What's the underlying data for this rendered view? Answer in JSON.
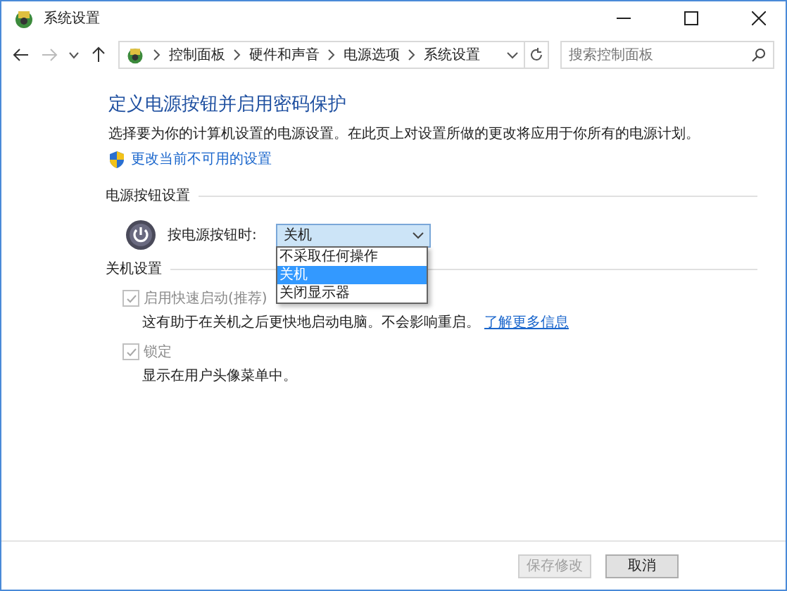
{
  "window": {
    "title": "系统设置"
  },
  "address_bar": {
    "breadcrumbs": [
      "控制面板",
      "硬件和声音",
      "电源选项",
      "系统设置"
    ]
  },
  "search": {
    "placeholder": "搜索控制面板"
  },
  "heading": "定义电源按钮并启用密码保护",
  "description": "选择要为你的计算机设置的电源设置。在此页上对设置所做的更改将应用于你所有的电源计划。",
  "admin_link": "更改当前不可用的设置",
  "power_section": {
    "title": "电源按钮设置",
    "label": "按电源按钮时:",
    "value": "关机",
    "expanded": true,
    "options": [
      {
        "label": "不采取任何操作",
        "selected": false
      },
      {
        "label": "关机",
        "selected": true
      },
      {
        "label": "关闭显示器",
        "selected": false
      }
    ]
  },
  "shutdown_section": {
    "title": "关机设置",
    "items": [
      {
        "label": "启用快速启动(推荐)",
        "checked": true,
        "disabled": true,
        "description": "这有助于在关机之后更快地启动电脑。不会影响重启。",
        "link": "了解更多信息"
      },
      {
        "label": "锁定",
        "checked": true,
        "disabled": true,
        "description": "显示在用户头像菜单中。"
      }
    ]
  },
  "buttons": [
    {
      "label": "保存修改",
      "disabled": true
    },
    {
      "label": "取消",
      "disabled": false
    }
  ]
}
